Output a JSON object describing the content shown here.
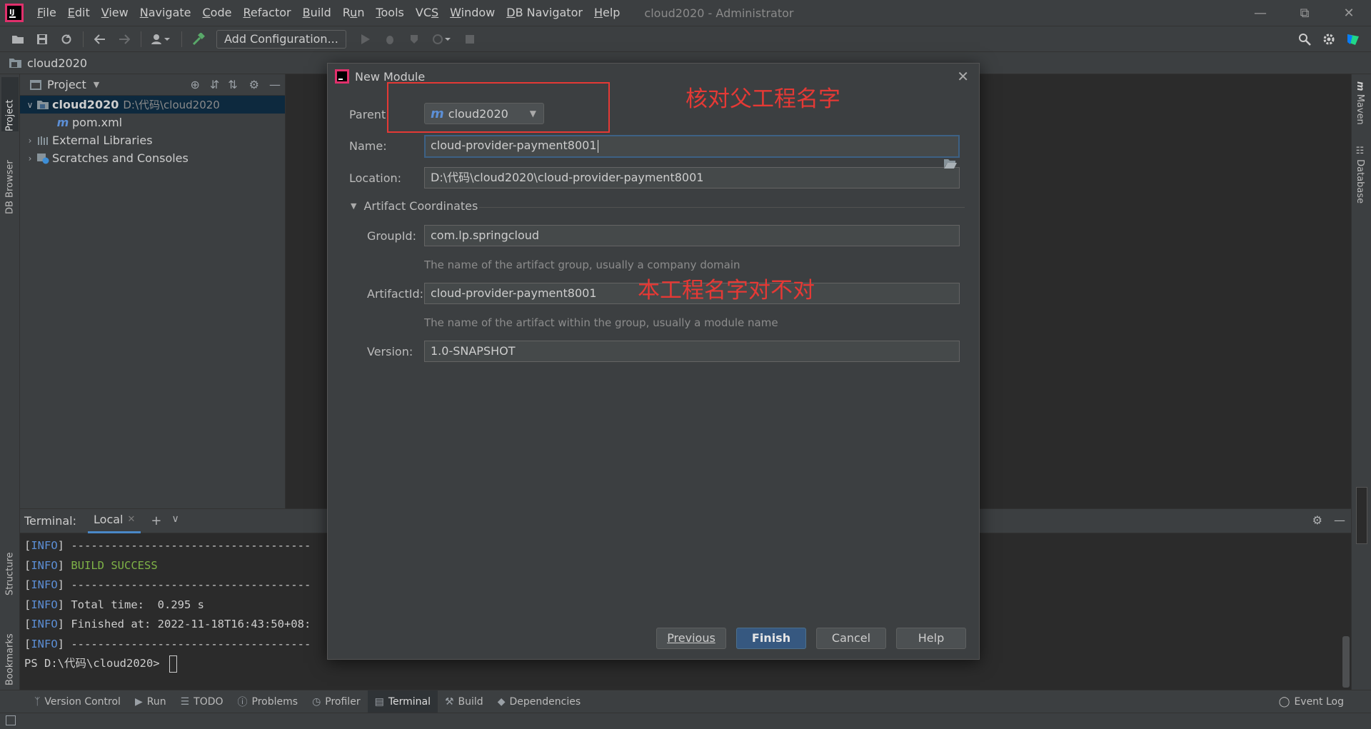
{
  "menubar": {
    "items": [
      {
        "label": "File",
        "mnemonic": "F"
      },
      {
        "label": "Edit",
        "mnemonic": "E"
      },
      {
        "label": "View",
        "mnemonic": "V"
      },
      {
        "label": "Navigate",
        "mnemonic": "N"
      },
      {
        "label": "Code",
        "mnemonic": "C"
      },
      {
        "label": "Refactor",
        "mnemonic": "R"
      },
      {
        "label": "Build",
        "mnemonic": "B"
      },
      {
        "label": "Run",
        "mnemonic": "u"
      },
      {
        "label": "Tools",
        "mnemonic": "T"
      },
      {
        "label": "VCS",
        "mnemonic": "S"
      },
      {
        "label": "Window",
        "mnemonic": "W"
      },
      {
        "label": "DB Navigator",
        "mnemonic": "D"
      },
      {
        "label": "Help",
        "mnemonic": "H"
      }
    ],
    "window_title": "cloud2020 - Administrator"
  },
  "toolbar": {
    "add_config_label": "Add Configuration..."
  },
  "breadcrumb": {
    "project": "cloud2020"
  },
  "left_strip": {
    "project_tab": "Project",
    "db_browser_tab": "DB Browser",
    "structure_tab": "Structure",
    "bookmarks_tab": "Bookmarks"
  },
  "right_strip": {
    "maven_tab": "Maven",
    "database_tab": "Database"
  },
  "project_panel": {
    "title": "Project",
    "tree": {
      "root_name": "cloud2020",
      "root_path": "D:\\代码\\cloud2020",
      "pom": "pom.xml",
      "external": "External Libraries",
      "scratches": "Scratches and Consoles"
    }
  },
  "terminal": {
    "title": "Terminal:",
    "tab_label": "Local",
    "lines": [
      {
        "prefix": "[INFO]",
        "text": " ------------------------------------"
      },
      {
        "prefix": "[INFO]",
        "text": " BUILD SUCCESS"
      },
      {
        "prefix": "[INFO]",
        "text": " ------------------------------------"
      },
      {
        "prefix": "[INFO]",
        "text": " Total time:  0.295 s"
      },
      {
        "prefix": "[INFO]",
        "text": " Finished at: 2022-11-18T16:43:50+08:"
      },
      {
        "prefix": "[INFO]",
        "text": " ------------------------------------"
      }
    ],
    "prompt": "PS D:\\代码\\cloud2020> "
  },
  "bottombar": {
    "tabs": [
      "Version Control",
      "Run",
      "TODO",
      "Problems",
      "Profiler",
      "Terminal",
      "Build",
      "Dependencies"
    ],
    "event_log": "Event Log"
  },
  "dialog": {
    "title": "New Module",
    "parent_label": "Parent:",
    "parent_value": "cloud2020",
    "name_label": "Name:",
    "name_value": "cloud-provider-payment8001",
    "location_label": "Location:",
    "location_value": "D:\\代码\\cloud2020\\cloud-provider-payment8001",
    "section_label": "Artifact Coordinates",
    "groupid_label": "GroupId:",
    "groupid_value": "com.lp.springcloud",
    "groupid_hint": "The name of the artifact group, usually a company domain",
    "artifactid_label": "ArtifactId:",
    "artifactid_value": "cloud-provider-payment8001",
    "artifactid_hint": "The name of the artifact within the group, usually a module name",
    "version_label": "Version:",
    "version_value": "1.0-SNAPSHOT",
    "buttons": {
      "previous": "Previous",
      "finish": "Finish",
      "cancel": "Cancel",
      "help": "Help"
    }
  },
  "annotations": {
    "parent_note": "核对父工程名字",
    "artifact_note": "本工程名字对不对",
    "color": "#e53935"
  },
  "colors": {
    "accent": "#4a88c7",
    "primary_button": "#365880",
    "info_blue": "#5c8fd6",
    "success_green": "#7fb347"
  }
}
